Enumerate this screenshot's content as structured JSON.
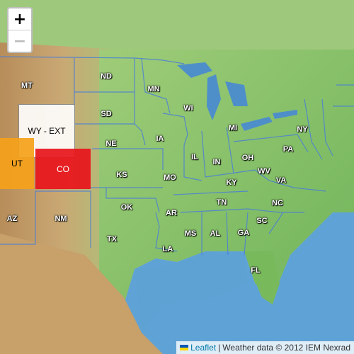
{
  "map": {
    "zoom_in_label": "+",
    "zoom_out_label": "−",
    "state_labels": [
      "MT",
      "ND",
      "MN",
      "SD",
      "WI",
      "MI",
      "NY",
      "NE",
      "IA",
      "IL",
      "IN",
      "OH",
      "PA",
      "KS",
      "MO",
      "KY",
      "WV",
      "VA",
      "OK",
      "AR",
      "TN",
      "NC",
      "AZ",
      "NM",
      "TX",
      "MS",
      "AL",
      "GA",
      "SC",
      "LA",
      "FL"
    ],
    "highlighted": [
      {
        "label": "WY - EXT",
        "color": "#fafafa"
      },
      {
        "label": "UT",
        "color": "#f5a11a"
      },
      {
        "label": "CO",
        "color": "#e8141c"
      }
    ]
  },
  "attribution": {
    "leaflet_link": "Leaflet",
    "separator": "|",
    "text": "Weather data © 2012 IEM Nexrad"
  },
  "colors": {
    "ocean": "#5fa3d6",
    "lakes": "#4e8fca",
    "land_green": "#8cc46a",
    "land_brown": "#c8a36f",
    "borders": "#4a7fd6"
  }
}
